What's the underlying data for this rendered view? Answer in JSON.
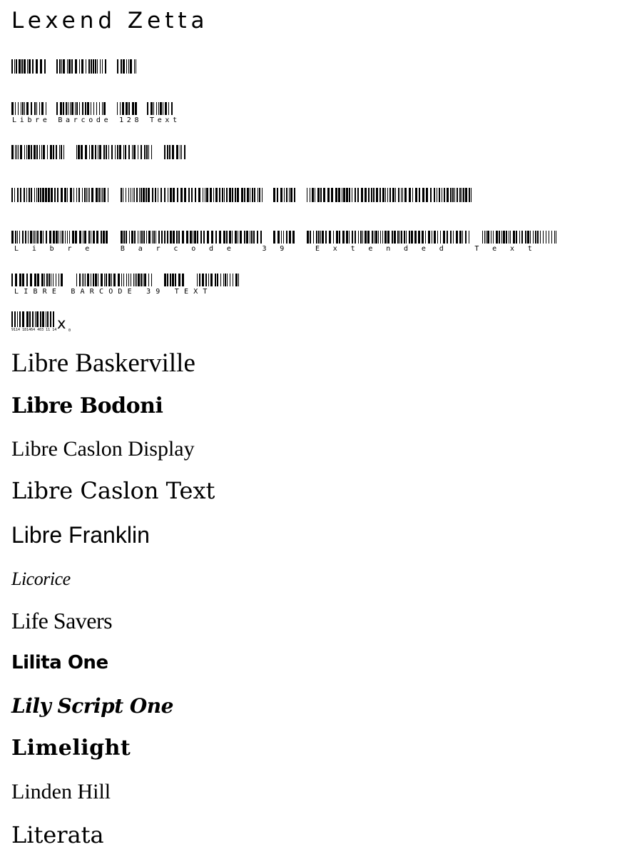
{
  "fonts": [
    {
      "key": "lexend",
      "label": "Lexend Zetta"
    },
    {
      "key": "barcode128",
      "label": "Libre Barcode 128"
    },
    {
      "key": "barcode128text",
      "label": "Libre Barcode 128 Text"
    },
    {
      "key": "barcode39",
      "label": "Libre Barcode 39"
    },
    {
      "key": "barcode39ext",
      "label": "Libre Barcode 39 Extended"
    },
    {
      "key": "barcode39exttext",
      "label": "Libre Barcode 39 Extended Text"
    },
    {
      "key": "barcode39text",
      "label": "LIBRE BARCODE 39 TEXT"
    },
    {
      "key": "barcodeean13",
      "label": "x",
      "digits": "9114 181464 403 11 14",
      "trailing": "0"
    },
    {
      "key": "baskerville",
      "label": "Libre Baskerville"
    },
    {
      "key": "bodoni",
      "label": "Libre Bodoni"
    },
    {
      "key": "caslondisp",
      "label": "Libre Caslon Display"
    },
    {
      "key": "caslontext",
      "label": "Libre Caslon Text"
    },
    {
      "key": "franklin",
      "label": "Libre Franklin"
    },
    {
      "key": "licorice",
      "label": "Licorice"
    },
    {
      "key": "lifesavers",
      "label": "Life Savers"
    },
    {
      "key": "lilita",
      "label": "Lilita One"
    },
    {
      "key": "lily",
      "label": "Lily Script One"
    },
    {
      "key": "limelight",
      "label": "Limelight"
    },
    {
      "key": "linden",
      "label": "Linden Hill"
    },
    {
      "key": "literata",
      "label": "Literata"
    }
  ]
}
